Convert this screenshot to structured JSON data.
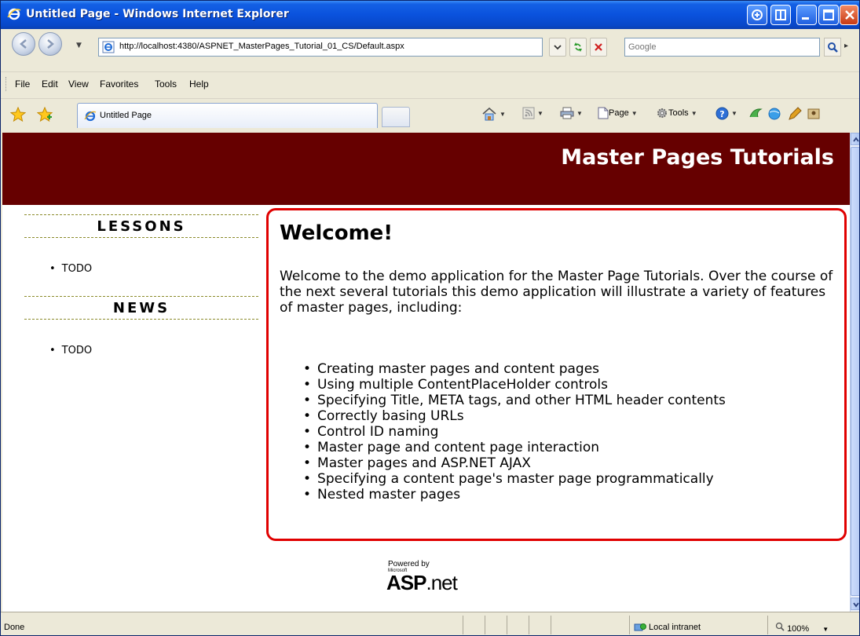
{
  "window": {
    "title": "Untitled Page - Windows Internet Explorer"
  },
  "address_bar": {
    "url": "http://localhost:4380/ASPNET_MasterPages_Tutorial_01_CS/Default.aspx",
    "search_placeholder": "Google"
  },
  "menu": [
    "File",
    "Edit",
    "View",
    "Favorites",
    "Tools",
    "Help"
  ],
  "tab": {
    "label": "Untitled Page"
  },
  "command_bar": {
    "page_label": "Page",
    "tools_label": "Tools"
  },
  "page": {
    "header_title": "Master Pages Tutorials",
    "sidebar": {
      "lessons_heading": "LESSONS",
      "lessons_items": [
        "TODO"
      ],
      "news_heading": "NEWS",
      "news_items": [
        "TODO"
      ]
    },
    "content": {
      "heading": "Welcome!",
      "intro": "Welcome to the demo application for the Master Page Tutorials. Over the course of the next several tutorials this demo application will illustrate a variety of features of master pages, including:",
      "features": [
        "Creating master pages and content pages",
        "Using multiple ContentPlaceHolder controls",
        "Specifying Title, META tags, and other HTML header contents",
        "Correctly basing URLs",
        "Control ID naming",
        "Master page and content page interaction",
        "Master pages and ASP.NET AJAX",
        "Specifying a content page's master page programmatically",
        "Nested master pages"
      ]
    },
    "powered_by": {
      "line1": "Powered by",
      "line2": "Microsoft",
      "asp_bold": "ASP",
      "asp_rest": ".net"
    }
  },
  "status_bar": {
    "status": "Done",
    "zone": "Local intranet",
    "zoom": "100%"
  },
  "colors": {
    "header_bg": "#660000",
    "content_border": "#e00000",
    "titlebar": "#0a52dd"
  }
}
